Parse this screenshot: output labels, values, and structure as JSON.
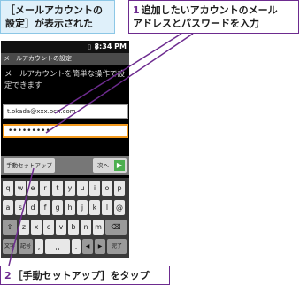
{
  "callouts": {
    "top_left": {
      "line1": "［メールアカウントの",
      "line2": "設定］が表示された"
    },
    "top_right": {
      "num": "1",
      "line1": "追加したいアカウントのメール",
      "line2": "アドレスとパスワードを入力"
    },
    "bottom_left": {
      "num": "2",
      "text": "［手動セットアップ］をタップ"
    }
  },
  "phone": {
    "status": {
      "icons": "▯ ▮",
      "time": "8:34 PM"
    },
    "title": "メールアカウントの設定",
    "description": {
      "line1": "メールアカウントを簡単な操作で設",
      "line2": "定できます"
    },
    "email_value": "t.okada@xxx.ocn.com",
    "password_value": "•••••••••",
    "manual_setup_label": "手動セットアップ",
    "next_label": "次へ",
    "keyboard": {
      "row1": [
        "q",
        "w",
        "e",
        "r",
        "t",
        "y",
        "u",
        "i",
        "o",
        "p"
      ],
      "row2": [
        "a",
        "s",
        "d",
        "f",
        "g",
        "h",
        "j",
        "k",
        "l",
        "@"
      ],
      "row3": [
        "⇧",
        "z",
        "x",
        "c",
        "v",
        "b",
        "n",
        "m",
        "⌫"
      ],
      "row4": [
        "文字",
        "記号",
        ",",
        "␣",
        ".",
        "◀",
        "▶",
        "完了"
      ]
    }
  }
}
